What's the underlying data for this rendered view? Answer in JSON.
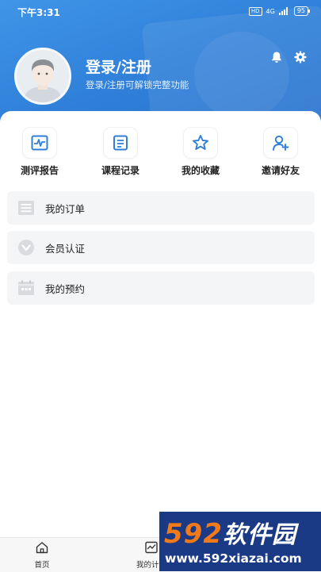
{
  "status_bar": {
    "time": "下午3:31",
    "hd": "HD",
    "network": "4G",
    "battery": "95"
  },
  "profile": {
    "title": "登录/注册",
    "subtitle": "登录/注册可解锁完整功能"
  },
  "header_icons": {
    "bell": "bell-icon",
    "settings": "gear-icon"
  },
  "quick_actions": [
    {
      "label": "测评报告",
      "icon": "report-chart-icon"
    },
    {
      "label": "课程记录",
      "icon": "course-record-icon"
    },
    {
      "label": "我的收藏",
      "icon": "star-icon"
    },
    {
      "label": "邀请好友",
      "icon": "invite-user-icon"
    }
  ],
  "menu": [
    {
      "label": "我的订单",
      "icon": "order-list-icon"
    },
    {
      "label": "会员认证",
      "icon": "member-badge-icon"
    },
    {
      "label": "我的预约",
      "icon": "calendar-icon"
    }
  ],
  "tabbar": [
    {
      "label": "首页",
      "icon": "home-icon"
    },
    {
      "label": "我的计划",
      "icon": "plan-chart-icon"
    }
  ],
  "watermark": {
    "brand_number": "592",
    "brand_text": "软件园",
    "url": "www.592xiazai.com"
  },
  "colors": {
    "header_blue": "#2f7fd8",
    "accent": "#2f7fd8",
    "watermark_bg": "#1b3a86",
    "watermark_orange": "#f07a1a"
  }
}
